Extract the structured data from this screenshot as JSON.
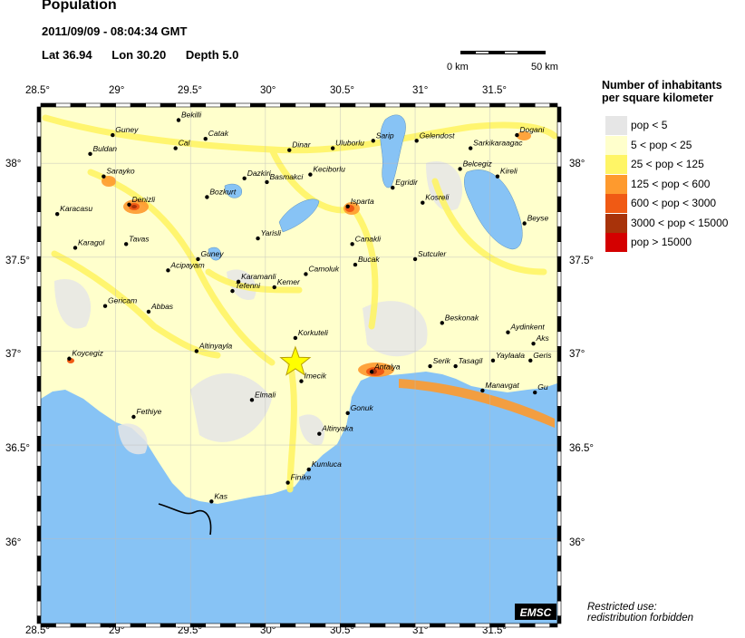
{
  "header": {
    "title": "Population",
    "datetime": "2011/09/09 - 08:04:34 GMT",
    "lat_label": "Lat 36.94",
    "lon_label": "Lon  30.20",
    "depth_label": "Depth  5.0"
  },
  "scale": {
    "start": "0 km",
    "end": "50 km"
  },
  "legend": {
    "title_line1": "Number of inhabitants",
    "title_line2": "per square kilometer",
    "items": [
      {
        "label": "pop < 5",
        "color": "#e6e6e6"
      },
      {
        "label": "5 < pop < 25",
        "color": "#ffffcc"
      },
      {
        "label": "25 < pop < 125",
        "color": "#fff566"
      },
      {
        "label": "125 < pop < 600",
        "color": "#fe9a2e"
      },
      {
        "label": "600 < pop < 3000",
        "color": "#f05a14"
      },
      {
        "label": "3000 < pop < 15000",
        "color": "#a8330a"
      },
      {
        "label": "pop > 15000",
        "color": "#d40000"
      }
    ]
  },
  "map": {
    "lon_min": 28.5,
    "lon_max": 31.95,
    "lat_min": 35.55,
    "lat_max": 38.3,
    "lon_ticks": [
      "28.5°",
      "29°",
      "29.5°",
      "30°",
      "30.5°",
      "31°",
      "31.5°"
    ],
    "lon_tick_values": [
      28.5,
      29,
      29.5,
      30,
      30.5,
      31,
      31.5
    ],
    "lat_ticks": [
      "38°",
      "37.5°",
      "37°",
      "36.5°",
      "36°"
    ],
    "lat_tick_values": [
      38,
      37.5,
      37,
      36.5,
      36
    ],
    "epicenter": {
      "lat": 36.94,
      "lon": 30.2
    },
    "sea_color": "#87c3f5",
    "land_color": "#ffffcc",
    "logo_text": "EMSC",
    "cities": [
      {
        "name": "Bekilli",
        "lat": 38.23,
        "lon": 29.42
      },
      {
        "name": "Guney",
        "lat": 38.15,
        "lon": 28.98
      },
      {
        "name": "Cal",
        "lat": 38.08,
        "lon": 29.4
      },
      {
        "name": "Catak",
        "lat": 38.13,
        "lon": 29.6
      },
      {
        "name": "Dinar",
        "lat": 38.07,
        "lon": 30.16
      },
      {
        "name": "Uluborlu",
        "lat": 38.08,
        "lon": 30.45
      },
      {
        "name": "Sarip",
        "lat": 38.12,
        "lon": 30.72
      },
      {
        "name": "Gelendost",
        "lat": 38.12,
        "lon": 31.01
      },
      {
        "name": "Dogani",
        "lat": 38.15,
        "lon": 31.68
      },
      {
        "name": "Sarkikaraagac",
        "lat": 38.08,
        "lon": 31.37
      },
      {
        "name": "Buldan",
        "lat": 38.05,
        "lon": 28.83
      },
      {
        "name": "Belcegiz",
        "lat": 37.97,
        "lon": 31.3
      },
      {
        "name": "Kireli",
        "lat": 37.93,
        "lon": 31.55
      },
      {
        "name": "Sarayko",
        "lat": 37.93,
        "lon": 28.92
      },
      {
        "name": "Basmakci",
        "lat": 37.9,
        "lon": 30.01
      },
      {
        "name": "Keciborlu",
        "lat": 37.94,
        "lon": 30.3
      },
      {
        "name": "Dazkiri",
        "lat": 37.92,
        "lon": 29.86
      },
      {
        "name": "Egridir",
        "lat": 37.87,
        "lon": 30.85
      },
      {
        "name": "Bozkurt",
        "lat": 37.82,
        "lon": 29.61
      },
      {
        "name": "Denizli",
        "lat": 37.78,
        "lon": 29.09
      },
      {
        "name": "Isparta",
        "lat": 37.77,
        "lon": 30.55
      },
      {
        "name": "Kosreli",
        "lat": 37.79,
        "lon": 31.05
      },
      {
        "name": "Beyse",
        "lat": 37.68,
        "lon": 31.73
      },
      {
        "name": "Karacasu",
        "lat": 37.73,
        "lon": 28.61
      },
      {
        "name": "Yarisli",
        "lat": 37.6,
        "lon": 29.95
      },
      {
        "name": "Canakli",
        "lat": 37.57,
        "lon": 30.58
      },
      {
        "name": "Karagol",
        "lat": 37.55,
        "lon": 28.73
      },
      {
        "name": "Tavas",
        "lat": 37.57,
        "lon": 29.07
      },
      {
        "name": "Guney",
        "lat": 37.49,
        "lon": 29.55
      },
      {
        "name": "Sutculer",
        "lat": 37.49,
        "lon": 31.0
      },
      {
        "name": "Camoluk",
        "lat": 37.41,
        "lon": 30.27
      },
      {
        "name": "Bucak",
        "lat": 37.46,
        "lon": 30.6
      },
      {
        "name": "Acipayam",
        "lat": 37.43,
        "lon": 29.35
      },
      {
        "name": "Karamanli",
        "lat": 37.37,
        "lon": 29.82
      },
      {
        "name": "Kemer",
        "lat": 37.34,
        "lon": 30.06
      },
      {
        "name": "Tefenni",
        "lat": 37.32,
        "lon": 29.78
      },
      {
        "name": "Gericam",
        "lat": 37.24,
        "lon": 28.93
      },
      {
        "name": "Abbas",
        "lat": 37.21,
        "lon": 29.22
      },
      {
        "name": "Beskonak",
        "lat": 37.15,
        "lon": 31.18
      },
      {
        "name": "Korkuteli",
        "lat": 37.07,
        "lon": 30.2
      },
      {
        "name": "Aydinkent",
        "lat": 37.1,
        "lon": 31.62
      },
      {
        "name": "Aks",
        "lat": 37.04,
        "lon": 31.79
      },
      {
        "name": "Altinyayla",
        "lat": 37.0,
        "lon": 29.54
      },
      {
        "name": "Koycegiz",
        "lat": 36.96,
        "lon": 28.69
      },
      {
        "name": "Yaylaala",
        "lat": 36.95,
        "lon": 31.52
      },
      {
        "name": "Geris",
        "lat": 36.95,
        "lon": 31.77
      },
      {
        "name": "Antalya",
        "lat": 36.89,
        "lon": 30.71
      },
      {
        "name": "Serik",
        "lat": 36.92,
        "lon": 31.1
      },
      {
        "name": "Tasagil",
        "lat": 36.92,
        "lon": 31.27
      },
      {
        "name": "Imecik",
        "lat": 36.84,
        "lon": 30.24
      },
      {
        "name": "Manavgat",
        "lat": 36.79,
        "lon": 31.45
      },
      {
        "name": "Gu",
        "lat": 36.78,
        "lon": 31.8
      },
      {
        "name": "Elmali",
        "lat": 36.74,
        "lon": 29.91
      },
      {
        "name": "Fethiye",
        "lat": 36.65,
        "lon": 29.12
      },
      {
        "name": "Gonuk",
        "lat": 36.67,
        "lon": 30.55
      },
      {
        "name": "Altinyaka",
        "lat": 36.56,
        "lon": 30.36
      },
      {
        "name": "Kumluca",
        "lat": 36.37,
        "lon": 30.29
      },
      {
        "name": "Finike",
        "lat": 36.3,
        "lon": 30.15
      },
      {
        "name": "Kas",
        "lat": 36.2,
        "lon": 29.64
      }
    ]
  }
}
